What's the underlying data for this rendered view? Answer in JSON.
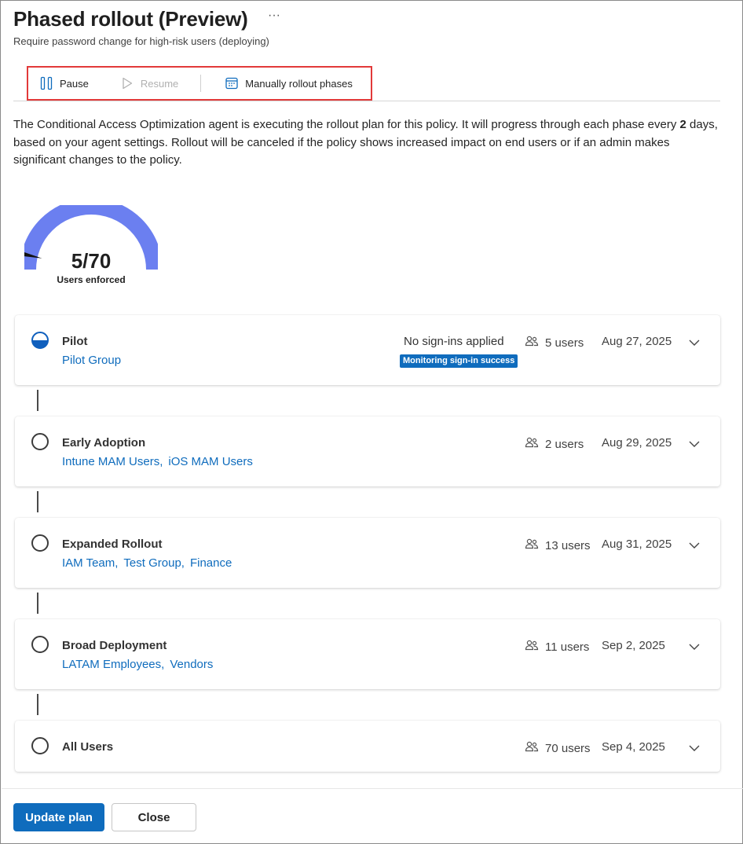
{
  "header": {
    "title": "Phased rollout (Preview)",
    "more_label": "···",
    "subtitle": "Require password change for high-risk users (deploying)"
  },
  "toolbar": {
    "pause_label": "Pause",
    "resume_label": "Resume",
    "manual_label": "Manually rollout phases"
  },
  "description": {
    "part1": "The Conditional Access Optimization agent is executing the rollout plan for this policy. It will progress through each phase every ",
    "days": "2",
    "part2": " days, based on your agent settings. Rollout will be canceled if the policy shows increased impact on end users or if an admin makes significant changes to the policy."
  },
  "gauge": {
    "value_text": "5/70",
    "label": "Users enforced",
    "enforced": 5,
    "total": 70,
    "color": "#6b7ff0"
  },
  "phases": [
    {
      "name": "Pilot",
      "groups": [
        "Pilot Group"
      ],
      "status": "No sign-ins applied",
      "badge": "Monitoring sign-in success",
      "users": "5 users",
      "date": "Aug 27, 2025",
      "state": "in-progress"
    },
    {
      "name": "Early Adoption",
      "groups": [
        "Intune MAM Users,",
        "iOS MAM Users"
      ],
      "users": "2 users",
      "date": "Aug 29, 2025",
      "state": "pending"
    },
    {
      "name": "Expanded Rollout",
      "groups": [
        "IAM Team,",
        "Test Group,",
        "Finance"
      ],
      "users": "13 users",
      "date": "Aug 31, 2025",
      "state": "pending"
    },
    {
      "name": "Broad Deployment",
      "groups": [
        "LATAM Employees,",
        "Vendors"
      ],
      "users": "11 users",
      "date": "Sep 2, 2025",
      "state": "pending"
    },
    {
      "name": "All Users",
      "groups": [],
      "users": "70 users",
      "date": "Sep 4, 2025",
      "state": "pending"
    }
  ],
  "footer": {
    "update_label": "Update plan",
    "close_label": "Close"
  },
  "colors": {
    "accent": "#0f6cbd",
    "highlight_border": "#e23a3a"
  },
  "icons": {
    "pause": "pause-icon",
    "resume": "play-icon",
    "manual": "calendar-icon",
    "users": "people-icon",
    "expand": "chevron-down-icon"
  }
}
